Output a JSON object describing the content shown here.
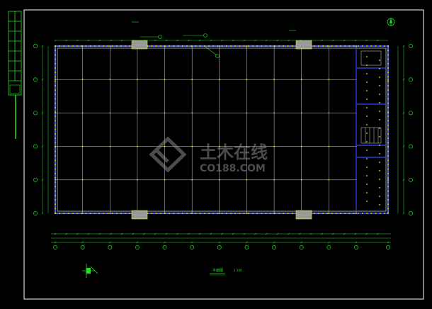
{
  "watermark": {
    "cn": "土木在线",
    "en": "CO188.COM",
    "color": "#6a6a6a"
  },
  "plan_title": "平面图",
  "scale_note": "1:100",
  "colors": {
    "background": "#000000",
    "frame": "#ffffff",
    "grid_line": "#d7d7d7",
    "wall": "#2b3fd6",
    "column": "#e8e820",
    "dimension": "#22e022",
    "axis_bubble": "#22e022",
    "accent": "#d8d8d8"
  },
  "icons": {
    "north_arrow": "north-arrow-icon",
    "section_marker": "section-marker-icon"
  }
}
